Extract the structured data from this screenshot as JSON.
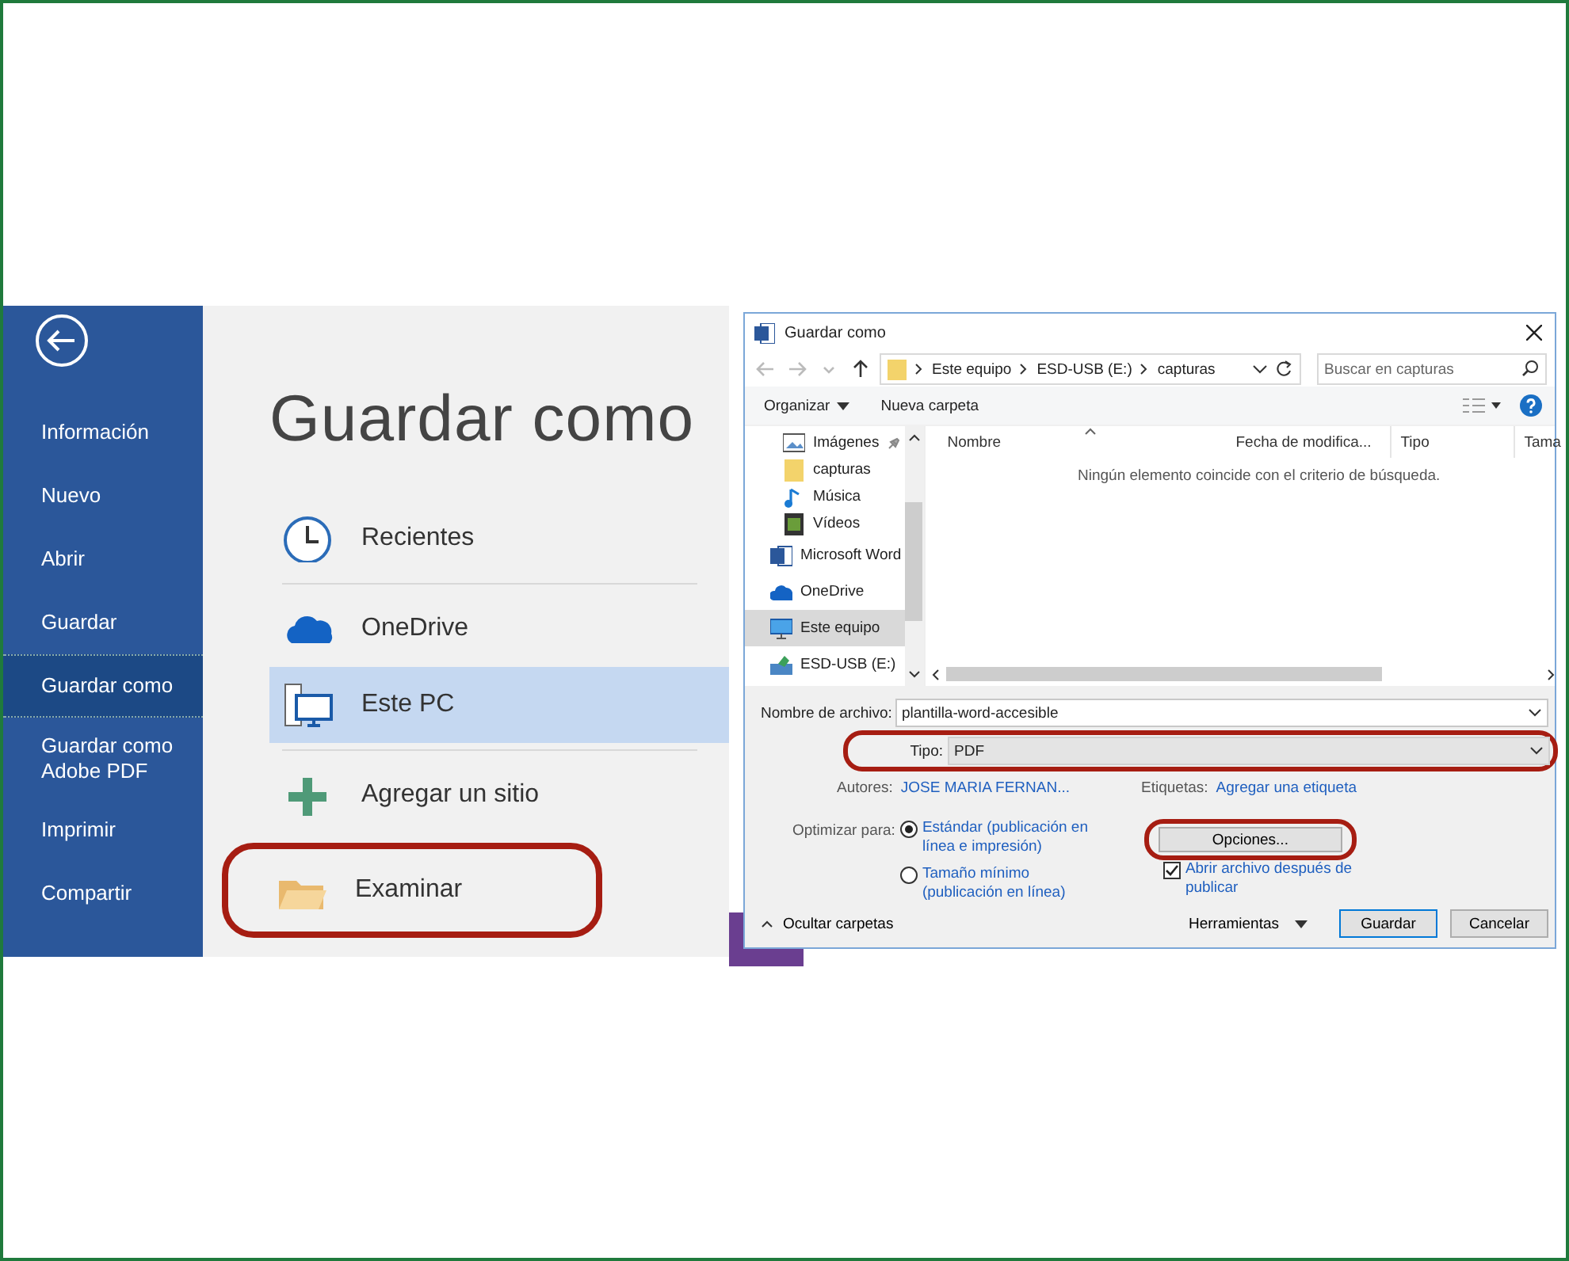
{
  "backstage": {
    "menu": [
      {
        "label": "Información",
        "selected": false
      },
      {
        "label": "Nuevo",
        "selected": false
      },
      {
        "label": "Abrir",
        "selected": false
      },
      {
        "label": "Guardar",
        "selected": false
      },
      {
        "label": "Guardar como",
        "selected": true
      },
      {
        "label": "Guardar como Adobe PDF",
        "selected": false
      },
      {
        "label": "Imprimir",
        "selected": false
      },
      {
        "label": "Compartir",
        "selected": false
      }
    ],
    "title": "Guardar como",
    "locations": [
      {
        "kind": "recent",
        "label": "Recientes",
        "selected": false,
        "highlighted": false
      },
      {
        "kind": "onedrive",
        "label": "OneDrive",
        "selected": false,
        "highlighted": false
      },
      {
        "kind": "pc",
        "label": "Este PC",
        "selected": true,
        "highlighted": false
      },
      {
        "kind": "add",
        "label": "Agregar un sitio",
        "selected": false,
        "highlighted": false
      },
      {
        "kind": "browse",
        "label": "Examinar",
        "selected": false,
        "highlighted": true
      }
    ]
  },
  "dialog": {
    "title": "Guardar como",
    "breadcrumb": [
      "Este equipo",
      "ESD-USB (E:)",
      "capturas"
    ],
    "search": {
      "placeholder": "Buscar en capturas"
    },
    "toolbar": [
      {
        "label": "Organizar",
        "dropdown": true
      },
      {
        "label": "Nueva carpeta",
        "dropdown": false
      }
    ],
    "nav": [
      {
        "kind": "pictures",
        "label": "Imágenes",
        "pinned": true,
        "selected": false
      },
      {
        "kind": "folder",
        "label": "capturas",
        "pinned": false,
        "selected": false
      },
      {
        "kind": "music",
        "label": "Música",
        "pinned": false,
        "selected": false
      },
      {
        "kind": "video",
        "label": "Vídeos",
        "pinned": false,
        "selected": false
      },
      {
        "kind": "word",
        "label": "Microsoft Word",
        "pinned": false,
        "selected": false
      },
      {
        "kind": "onedrive",
        "label": "OneDrive",
        "pinned": false,
        "selected": false
      },
      {
        "kind": "pc",
        "label": "Este equipo",
        "pinned": false,
        "selected": true
      },
      {
        "kind": "usb",
        "label": "ESD-USB (E:)",
        "pinned": false,
        "selected": false
      }
    ],
    "columns": [
      "Nombre",
      "Fecha de modifica...",
      "Tipo",
      "Tama"
    ],
    "empty_message": "Ningún elemento coincide con el criterio de búsqueda.",
    "filename": {
      "label": "Nombre de archivo:",
      "value": "plantilla-word-accesible"
    },
    "type": {
      "label": "Tipo:",
      "value": "PDF",
      "highlighted": true
    },
    "authors": {
      "label": "Autores:",
      "value": "JOSE MARIA FERNAN..."
    },
    "tags": {
      "label": "Etiquetas:",
      "value": "Agregar una etiqueta"
    },
    "optimize": {
      "label": "Optimizar para:",
      "options": [
        {
          "label": "Estándar (publicación en línea e impresión)",
          "selected": true
        },
        {
          "label": "Tamaño mínimo (publicación en línea)",
          "selected": false
        }
      ]
    },
    "options_button": {
      "label": "Opciones...",
      "highlighted": true
    },
    "open_after": {
      "label": "Abrir archivo después de publicar",
      "checked": true
    },
    "hide_folders": "Ocultar carpetas",
    "tools": "Herramientas",
    "buttons": [
      {
        "kind": "primary",
        "label": "Guardar"
      },
      {
        "kind": "normal",
        "label": "Cancelar"
      }
    ]
  }
}
